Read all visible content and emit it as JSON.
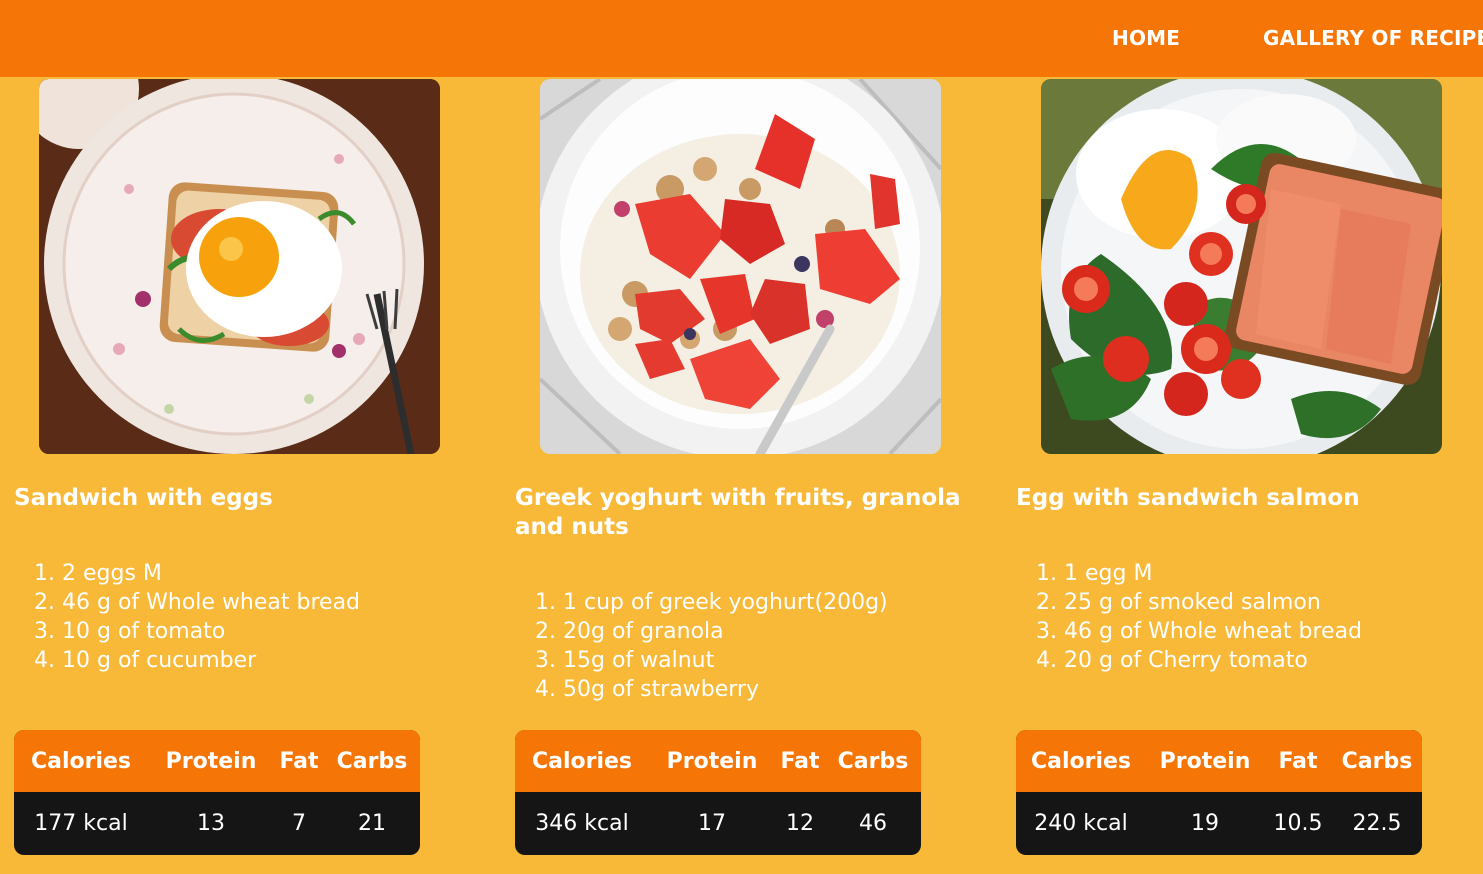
{
  "nav": {
    "home": "HOME",
    "gallery": "GALLERY OF RECIPES"
  },
  "colors": {
    "page_background": "#F9B938",
    "header_background": "#F57507",
    "table_header": "#F57507",
    "table_body": "#151515",
    "text": "#FFFFFF"
  },
  "recipes": [
    {
      "title": "Sandwich with eggs",
      "image": "photo of fried egg on toast with tomato on a floral plate",
      "ingredients": [
        "2 eggs M",
        "46 g of Whole wheat bread",
        "10 g of tomato",
        "10 g of cucumber"
      ],
      "nutrition": {
        "headers": [
          "Calories",
          "Protein",
          "Fat",
          "Carbs"
        ],
        "values": [
          "177 kcal",
          "13",
          "7",
          "21"
        ]
      }
    },
    {
      "title": "Greek yoghurt with fruits, granola and nuts",
      "image": "photo of a bowl of greek yoghurt with strawberries and granola",
      "ingredients": [
        "1 cup of greek yoghurt(200g)",
        "20g of granola",
        "15g of walnut",
        "50g of strawberry"
      ],
      "nutrition": {
        "headers": [
          "Calories",
          "Protein",
          "Fat",
          "Carbs"
        ],
        "values": [
          "346 kcal",
          "17",
          "12",
          "46"
        ]
      }
    },
    {
      "title": "Egg with sandwich salmon",
      "image": "photo of fried egg, spinach, cherry tomatoes and salmon on toast",
      "ingredients": [
        "1 egg M",
        "25 g of smoked salmon",
        "46 g of Whole wheat bread",
        "20 g of Cherry tomato"
      ],
      "nutrition": {
        "headers": [
          "Calories",
          "Protein",
          "Fat",
          "Carbs"
        ],
        "values": [
          "240 kcal",
          "19",
          "10.5",
          "22.5"
        ]
      }
    }
  ]
}
